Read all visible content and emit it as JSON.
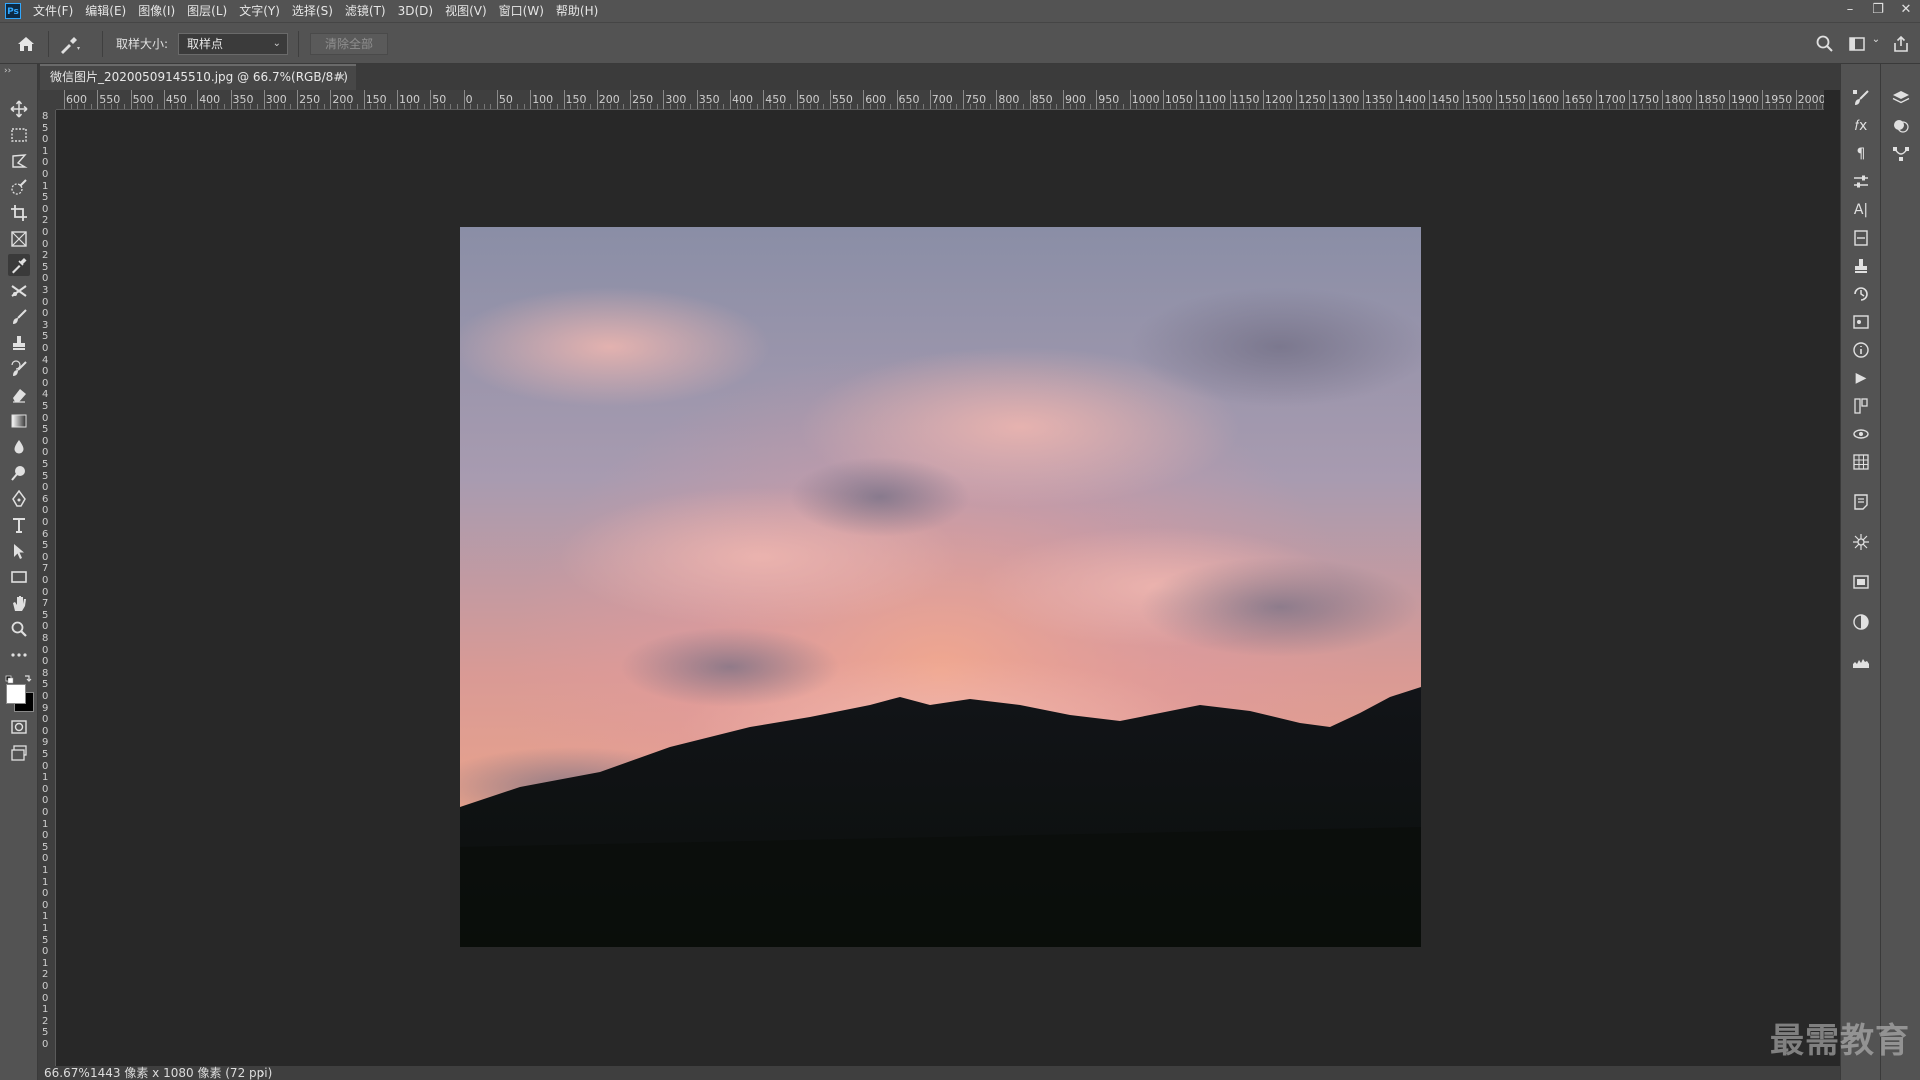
{
  "app": {
    "logo": "Ps"
  },
  "menu": [
    "文件(F)",
    "编辑(E)",
    "图像(I)",
    "图层(L)",
    "文字(Y)",
    "选择(S)",
    "滤镜(T)",
    "3D(D)",
    "视图(V)",
    "窗口(W)",
    "帮助(H)"
  ],
  "window_controls": {
    "minimize": "–",
    "restore": "❐",
    "close": "✕"
  },
  "options": {
    "sample_size_label": "取样大小:",
    "sample_size_value": "取样点",
    "clear_all_label": "清除全部"
  },
  "document": {
    "tab_title": "微信图片_20200509145510.jpg @ 66.7%(RGB/8#)",
    "tab_close": "×"
  },
  "ruler": {
    "horizontal": [
      "600",
      "550",
      "500",
      "450",
      "400",
      "350",
      "300",
      "250",
      "200",
      "150",
      "100",
      "50",
      "0",
      "50",
      "100",
      "150",
      "200",
      "250",
      "300",
      "350",
      "400",
      "450",
      "500",
      "550",
      "600",
      "650",
      "700",
      "750",
      "800",
      "850",
      "900",
      "950",
      "1000",
      "1050",
      "1100",
      "1150",
      "1200",
      "1250",
      "1300",
      "1350",
      "1400",
      "1450",
      "1500",
      "1550",
      "1600",
      "1650",
      "1700",
      "1750",
      "1800",
      "1850",
      "1900",
      "1950",
      "2000"
    ],
    "vertical": [
      "8",
      "5",
      "0",
      "1",
      "0",
      "0",
      "1",
      "5",
      "0",
      "2",
      "0",
      "0",
      "2",
      "5",
      "0",
      "3",
      "0",
      "0",
      "3",
      "5",
      "0",
      "4",
      "0",
      "0",
      "4",
      "5",
      "0",
      "5",
      "0",
      "0",
      "5",
      "5",
      "0",
      "6",
      "0",
      "0",
      "6",
      "5",
      "0",
      "7",
      "0",
      "0",
      "7",
      "5",
      "0",
      "8",
      "0",
      "0",
      "8",
      "5",
      "0",
      "9",
      "0",
      "0",
      "9",
      "5",
      "0",
      "1",
      "0",
      "0",
      "0",
      "1",
      "0",
      "5",
      "0",
      "1",
      "1",
      "0",
      "0",
      "1",
      "1",
      "5",
      "0",
      "1",
      "2",
      "0",
      "0",
      "1",
      "2",
      "5",
      "0"
    ]
  },
  "status": {
    "zoom": "66.67%",
    "doc_info": "1443 像素 x 1080 像素 (72 ppi)",
    "arrow": "›"
  },
  "watermark": "最需教育",
  "colors": {
    "accent": "#31a8ff",
    "panel": "#535353",
    "canvas_bg": "#282828"
  }
}
